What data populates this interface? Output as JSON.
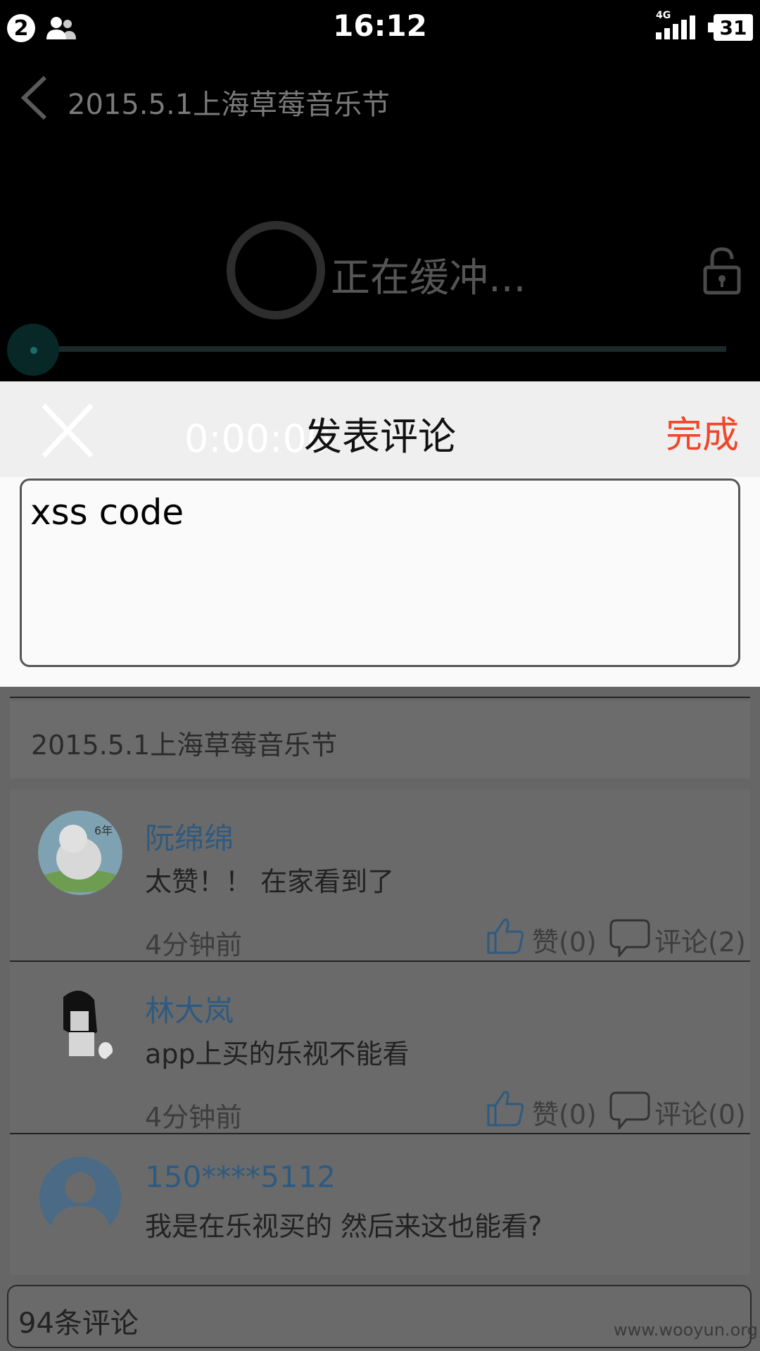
{
  "status_bar": {
    "notification_count": "2",
    "time": "16:12",
    "network": "4G",
    "battery": "31",
    "icons": [
      "contacts-icon",
      "signal-icon",
      "battery-icon"
    ]
  },
  "player": {
    "title": "2015.5.1上海草莓音乐节",
    "buffering_text": "正在缓冲...",
    "time": "0:00:00",
    "icons": [
      "back-icon",
      "loading-spinner",
      "lock-icon",
      "seek-knob"
    ]
  },
  "dialog": {
    "title": "发表评论",
    "done_label": "完成",
    "input_value": "xss code",
    "icons": [
      "close-icon"
    ]
  },
  "detail": {
    "title": "2015.5.1上海草莓音乐节"
  },
  "comments": [
    {
      "name": "阮绵绵",
      "text": "太赞！！ 在家看到了",
      "time": "4分钟前",
      "likes": "赞(0)",
      "replies": "评论(2)"
    },
    {
      "name": "林大岚",
      "text": "app上买的乐视不能看",
      "time": "4分钟前",
      "likes": "赞(0)",
      "replies": "评论(0)"
    },
    {
      "name": "150****5112",
      "text": "我是在乐视买的  然后来这也能看?",
      "time": "",
      "likes": "",
      "replies": ""
    }
  ],
  "bottom_bar": {
    "comment_count": "94条评论"
  },
  "watermark": "www.wooyun.org",
  "colors": {
    "accent": "#f0462a",
    "name_link": "#2f5a80",
    "dim_overlay": "#666666"
  }
}
